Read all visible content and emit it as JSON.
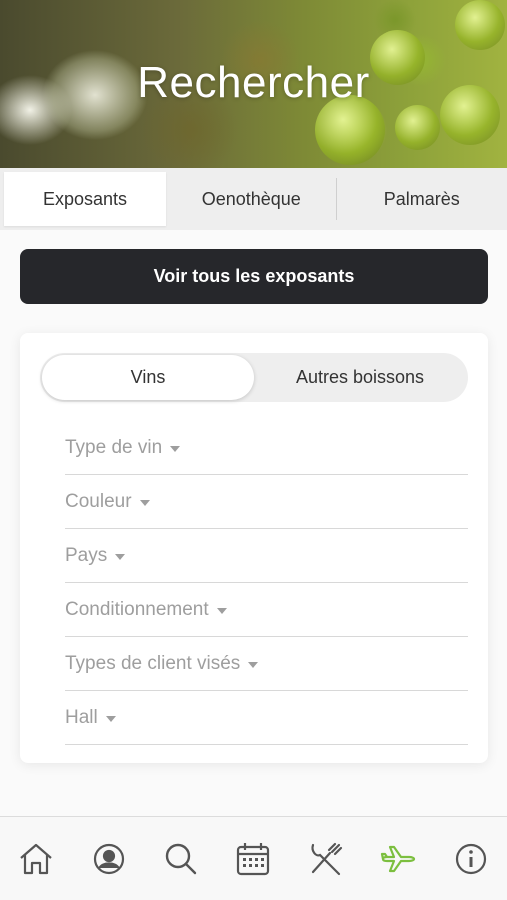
{
  "header": {
    "title": "Rechercher"
  },
  "tabs": [
    {
      "label": "Exposants",
      "active": true
    },
    {
      "label": "Oenothèque",
      "active": false
    },
    {
      "label": "Palmarès",
      "active": false
    }
  ],
  "cta": {
    "label": "Voir tous les exposants"
  },
  "segment": [
    {
      "label": "Vins",
      "active": true
    },
    {
      "label": "Autres boissons",
      "active": false
    }
  ],
  "filters": [
    {
      "label": "Type de vin"
    },
    {
      "label": "Couleur"
    },
    {
      "label": "Pays"
    },
    {
      "label": "Conditionnement"
    },
    {
      "label": "Types de client visés"
    },
    {
      "label": "Hall"
    }
  ],
  "nav": {
    "items": [
      {
        "icon": "home-icon"
      },
      {
        "icon": "profile-icon"
      },
      {
        "icon": "search-icon"
      },
      {
        "icon": "calendar-icon"
      },
      {
        "icon": "restaurant-icon"
      },
      {
        "icon": "airplane-icon",
        "active": true
      },
      {
        "icon": "info-icon"
      }
    ],
    "icon_color": "#555555",
    "active_color": "#7cbf3f"
  },
  "colors": {
    "cta_bg": "#26272b",
    "accent": "#7cbf3f"
  }
}
